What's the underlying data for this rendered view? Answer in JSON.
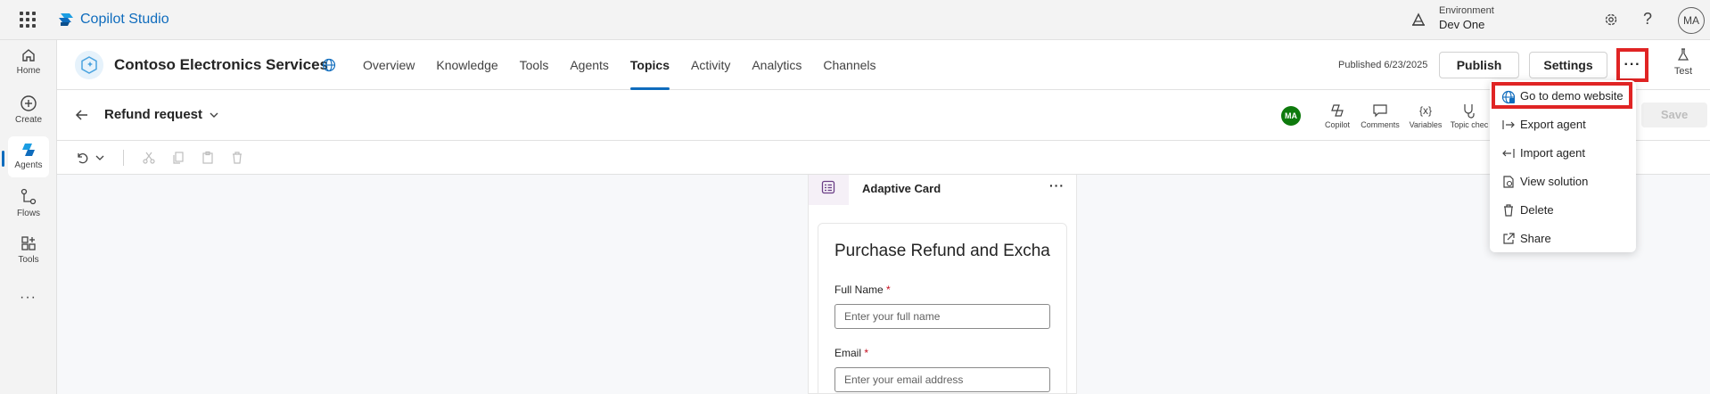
{
  "app": {
    "name": "Copilot Studio"
  },
  "environment": {
    "label": "Environment",
    "value": "Dev One"
  },
  "user": {
    "initials": "MA"
  },
  "icons": {
    "help": "?",
    "more": "···"
  },
  "rail": [
    {
      "label": "Home"
    },
    {
      "label": "Create"
    },
    {
      "label": "Agents"
    },
    {
      "label": "Flows"
    },
    {
      "label": "Tools"
    }
  ],
  "header": {
    "agent_name": "Contoso Electronics Services",
    "tabs": [
      {
        "label": "Overview"
      },
      {
        "label": "Knowledge"
      },
      {
        "label": "Tools"
      },
      {
        "label": "Agents"
      },
      {
        "label": "Topics"
      },
      {
        "label": "Activity"
      },
      {
        "label": "Analytics"
      },
      {
        "label": "Channels"
      }
    ],
    "published": "Published 6/23/2025",
    "publish_label": "Publish",
    "settings_label": "Settings",
    "test_label": "Test"
  },
  "topic": {
    "title": "Refund request",
    "avatar": "MA",
    "tools": [
      {
        "label": "Copilot"
      },
      {
        "label": "Comments"
      },
      {
        "label": "Variables"
      },
      {
        "label": "Topic chec"
      }
    ],
    "variables_glyph": "{x}",
    "save_label": "Save"
  },
  "card": {
    "title": "Adaptive Card",
    "form_title": "Purchase Refund and Excha",
    "fields": [
      {
        "label": "Full Name",
        "required": "*",
        "placeholder": "Enter your full name"
      },
      {
        "label": "Email",
        "required": "*",
        "placeholder": "Enter your email address"
      }
    ]
  },
  "menu": {
    "items": [
      {
        "label": "Go to demo website"
      },
      {
        "label": "Export agent"
      },
      {
        "label": "Import agent"
      },
      {
        "label": "View solution"
      },
      {
        "label": "Delete"
      },
      {
        "label": "Share"
      }
    ]
  },
  "colors": {
    "accent": "#0f6cbd",
    "highlight": "#e02424",
    "avatar_green": "#0e7a0d"
  }
}
